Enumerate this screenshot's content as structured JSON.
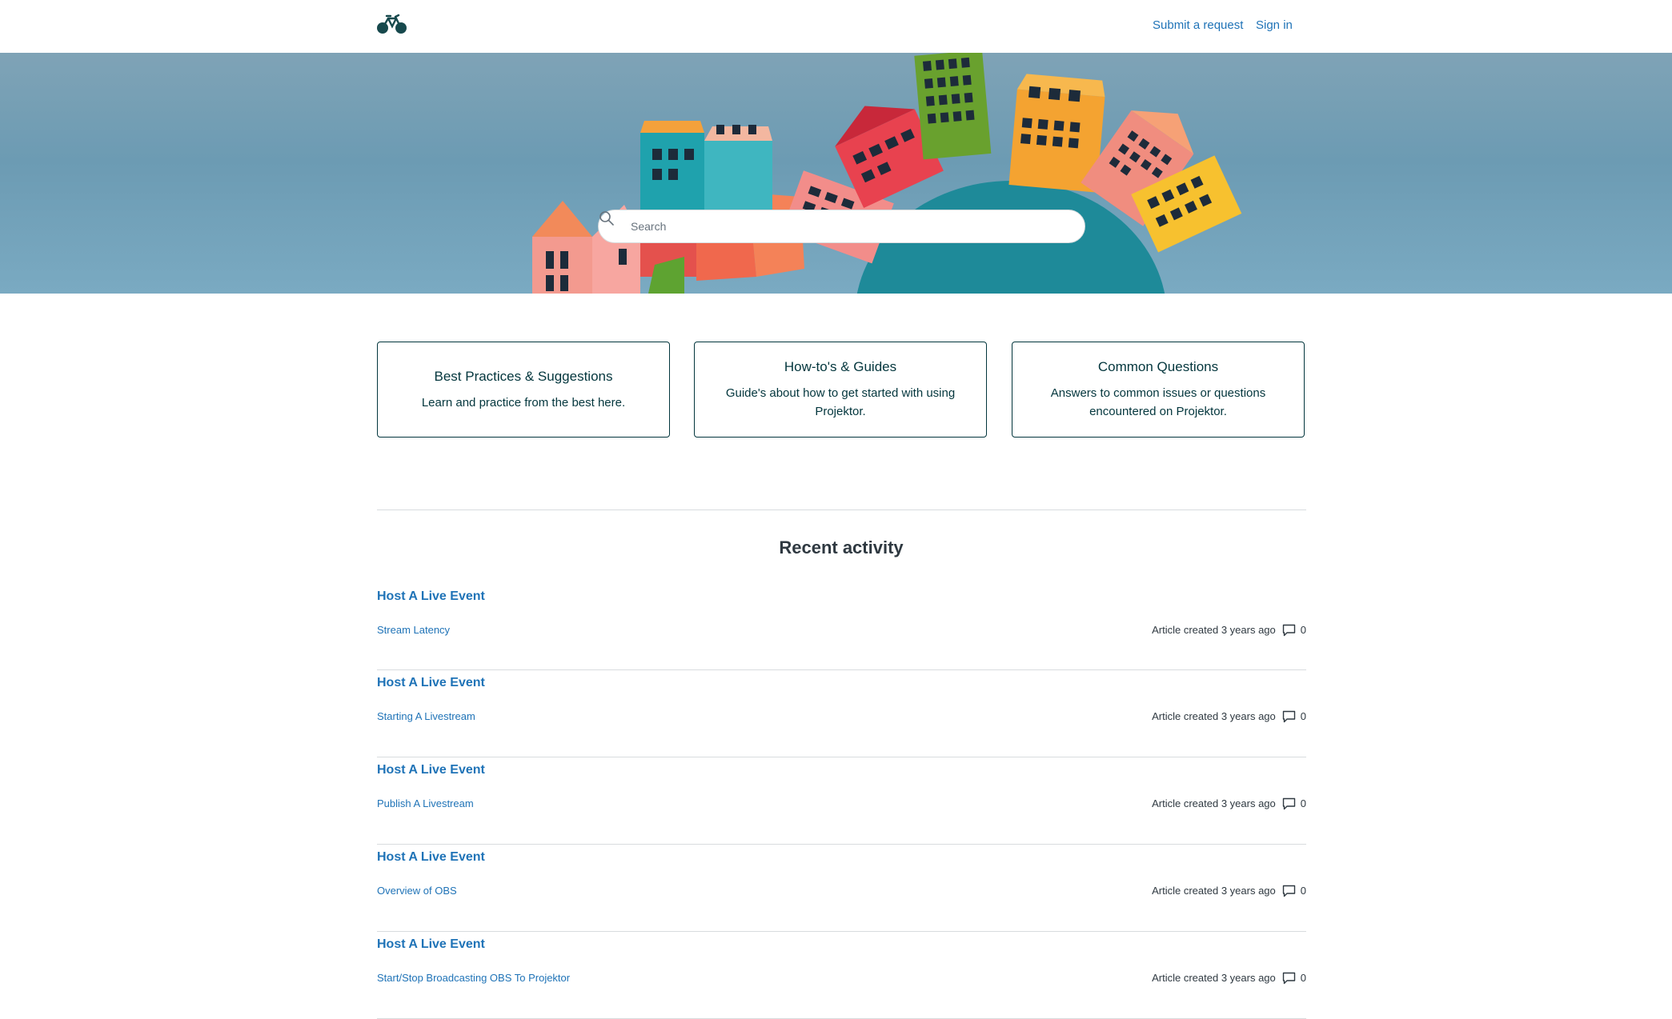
{
  "header": {
    "logo_icon": "bicycle-logo-icon",
    "submit_request": "Submit a request",
    "sign_in": "Sign in"
  },
  "hero": {
    "search": {
      "placeholder": "Search",
      "icon": "search-icon"
    }
  },
  "categories": [
    {
      "title": "Best Practices & Suggestions",
      "description": "Learn and practice from the best here."
    },
    {
      "title": "How-to's & Guides",
      "description": "Guide's about how to get started with using Projektor."
    },
    {
      "title": "Common Questions",
      "description": "Answers to common issues or questions encountered on Projektor."
    }
  ],
  "recent_activity": {
    "title": "Recent activity",
    "items": [
      {
        "section": "Host A Live Event",
        "article": "Stream Latency",
        "meta": "Article created 3 years ago",
        "comments": "0"
      },
      {
        "section": "Host A Live Event",
        "article": "Starting A Livestream",
        "meta": "Article created 3 years ago",
        "comments": "0"
      },
      {
        "section": "Host A Live Event",
        "article": "Publish A Livestream",
        "meta": "Article created 3 years ago",
        "comments": "0"
      },
      {
        "section": "Host A Live Event",
        "article": "Overview of OBS",
        "meta": "Article created 3 years ago",
        "comments": "0"
      },
      {
        "section": "Host A Live Event",
        "article": "Start/Stop Broadcasting OBS To Projektor",
        "meta": "Article created 3 years ago",
        "comments": "0"
      }
    ]
  },
  "colors": {
    "link": "#1f73b7",
    "brand_dark": "#03363d",
    "hero_bg": "#6c9bb3",
    "divider": "#d8dcde"
  }
}
